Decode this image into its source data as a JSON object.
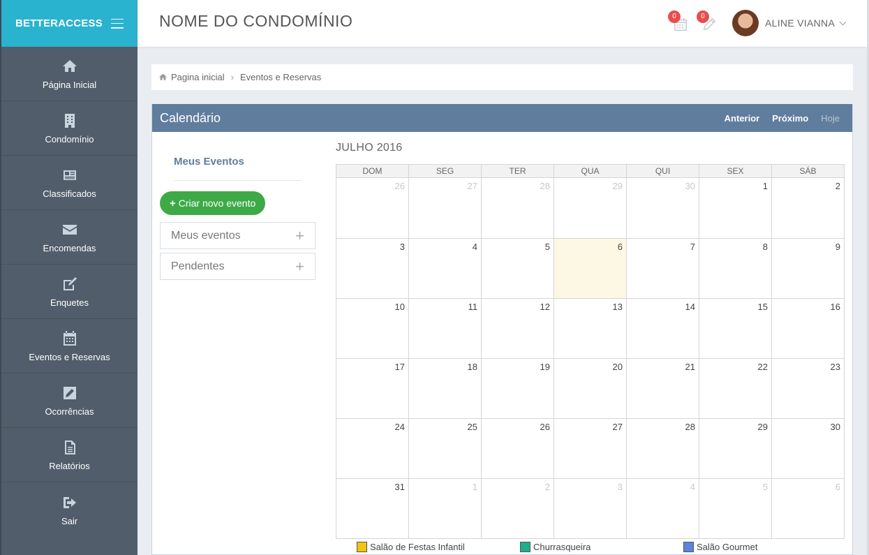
{
  "brand": {
    "bold": "BETTER",
    "light": "ACCESS"
  },
  "sidebar": {
    "items": [
      {
        "label": "Página Inicial",
        "icon": "home-icon"
      },
      {
        "label": "Condomínio",
        "icon": "building-icon"
      },
      {
        "label": "Classificados",
        "icon": "newspaper-icon"
      },
      {
        "label": "Encomendas",
        "icon": "envelope-icon"
      },
      {
        "label": "Enquetes",
        "icon": "edit-icon"
      },
      {
        "label": "Eventos e Reservas",
        "icon": "calendar-icon"
      },
      {
        "label": "Ocorrências",
        "icon": "pencil-square-icon"
      },
      {
        "label": "Relatórios",
        "icon": "document-icon"
      },
      {
        "label": "Sair",
        "icon": "sign-out-icon"
      }
    ]
  },
  "header": {
    "title": "NOME DO CONDOMÍNIO",
    "calendar_badge": "0",
    "edit_badge": "0",
    "user_name": "ALINE VIANNA"
  },
  "breadcrumb": {
    "home": "Pagina inicial",
    "current": "Eventos e Reservas"
  },
  "calendar": {
    "title": "Calendário",
    "nav": {
      "prev": "Anterior",
      "next": "Próximo",
      "today": "Hoje"
    },
    "month": "JULHO 2016",
    "weekdays": [
      "DOM",
      "SEG",
      "TER",
      "QUA",
      "QUI",
      "SEX",
      "SÁB"
    ],
    "weeks": [
      [
        {
          "d": "26",
          "other": true
        },
        {
          "d": "27",
          "other": true
        },
        {
          "d": "28",
          "other": true
        },
        {
          "d": "29",
          "other": true
        },
        {
          "d": "30",
          "other": true
        },
        {
          "d": "1"
        },
        {
          "d": "2"
        }
      ],
      [
        {
          "d": "3"
        },
        {
          "d": "4"
        },
        {
          "d": "5"
        },
        {
          "d": "6",
          "today": true
        },
        {
          "d": "7"
        },
        {
          "d": "8"
        },
        {
          "d": "9"
        }
      ],
      [
        {
          "d": "10"
        },
        {
          "d": "11"
        },
        {
          "d": "12"
        },
        {
          "d": "13"
        },
        {
          "d": "14"
        },
        {
          "d": "15"
        },
        {
          "d": "16"
        }
      ],
      [
        {
          "d": "17"
        },
        {
          "d": "18"
        },
        {
          "d": "19"
        },
        {
          "d": "20"
        },
        {
          "d": "21"
        },
        {
          "d": "22"
        },
        {
          "d": "23"
        }
      ],
      [
        {
          "d": "24"
        },
        {
          "d": "25"
        },
        {
          "d": "26"
        },
        {
          "d": "27"
        },
        {
          "d": "28"
        },
        {
          "d": "29"
        },
        {
          "d": "30"
        }
      ],
      [
        {
          "d": "31"
        },
        {
          "d": "1",
          "other": true
        },
        {
          "d": "2",
          "other": true
        },
        {
          "d": "3",
          "other": true
        },
        {
          "d": "4",
          "other": true
        },
        {
          "d": "5",
          "other": true
        },
        {
          "d": "6",
          "other": true
        }
      ]
    ]
  },
  "events_panel": {
    "title": "Meus Eventos",
    "create_label": "Criar novo evento",
    "sections": [
      "Meus eventos",
      "Pendentes"
    ]
  },
  "legend": [
    {
      "label": "Salão de Festas Infantil",
      "color": "#f2c311"
    },
    {
      "label": "Churrasqueira",
      "color": "#1fae8c"
    },
    {
      "label": "Salão Gourmet",
      "color": "#5b84e0"
    }
  ]
}
